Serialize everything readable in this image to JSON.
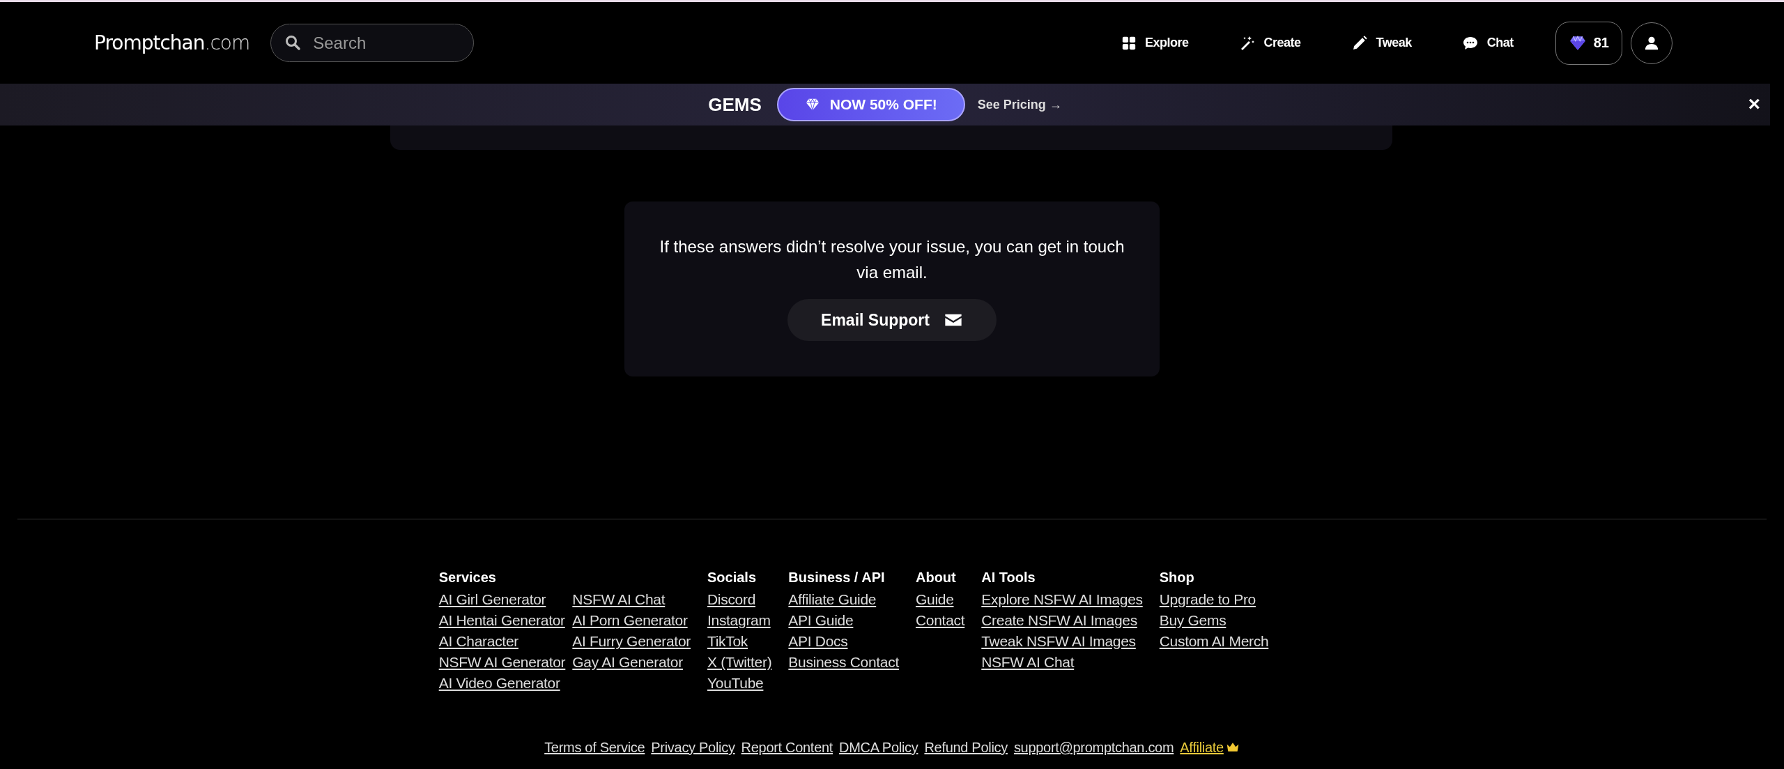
{
  "header": {
    "logo": {
      "name": "Promptchan",
      "suffix": ".com"
    },
    "search": {
      "placeholder": "Search"
    },
    "nav": [
      {
        "label": "Explore"
      },
      {
        "label": "Create"
      },
      {
        "label": "Tweak"
      },
      {
        "label": "Chat"
      }
    ],
    "gems_count": "81"
  },
  "banner": {
    "title": "GEMS",
    "offer": "NOW 50% OFF!",
    "link": "See Pricing →",
    "close": "×"
  },
  "support": {
    "message": "If these answers didn’t resolve your issue, you can get in touch via email.",
    "button": "Email Support"
  },
  "footer": {
    "columns": [
      {
        "heading": "Services",
        "link_columns": [
          [
            "AI Girl Generator",
            "AI Hentai Generator",
            "AI Character",
            "NSFW AI Generator",
            "AI Video Generator"
          ],
          [
            "NSFW AI Chat",
            "AI Porn Generator",
            "AI Furry Generator",
            "Gay AI Generator"
          ]
        ]
      },
      {
        "heading": "Socials",
        "link_columns": [
          [
            "Discord",
            "Instagram",
            "TikTok",
            "X (Twitter)",
            "YouTube"
          ]
        ]
      },
      {
        "heading": "Business / API",
        "link_columns": [
          [
            "Affiliate Guide",
            "API Guide",
            "API Docs",
            "Business Contact"
          ]
        ]
      },
      {
        "heading": "About",
        "link_columns": [
          [
            "Guide",
            "Contact"
          ]
        ]
      },
      {
        "heading": "AI Tools",
        "link_columns": [
          [
            "Explore NSFW AI Images",
            "Create NSFW AI Images",
            "Tweak NSFW AI Images",
            "NSFW AI Chat"
          ]
        ]
      },
      {
        "heading": "Shop",
        "link_columns": [
          [
            "Upgrade to Pro",
            "Buy Gems",
            "Custom AI Merch"
          ]
        ]
      }
    ],
    "bottom_links": [
      {
        "label": "Terms of Service",
        "kind": "plain"
      },
      {
        "label": "Privacy Policy",
        "kind": "plain"
      },
      {
        "label": "Report Content",
        "kind": "plain"
      },
      {
        "label": "DMCA Policy",
        "kind": "plain"
      },
      {
        "label": "Refund Policy",
        "kind": "plain"
      },
      {
        "label": "support@promptchan.com",
        "kind": "plain"
      },
      {
        "label": "Affiliate",
        "kind": "highlight"
      }
    ]
  }
}
